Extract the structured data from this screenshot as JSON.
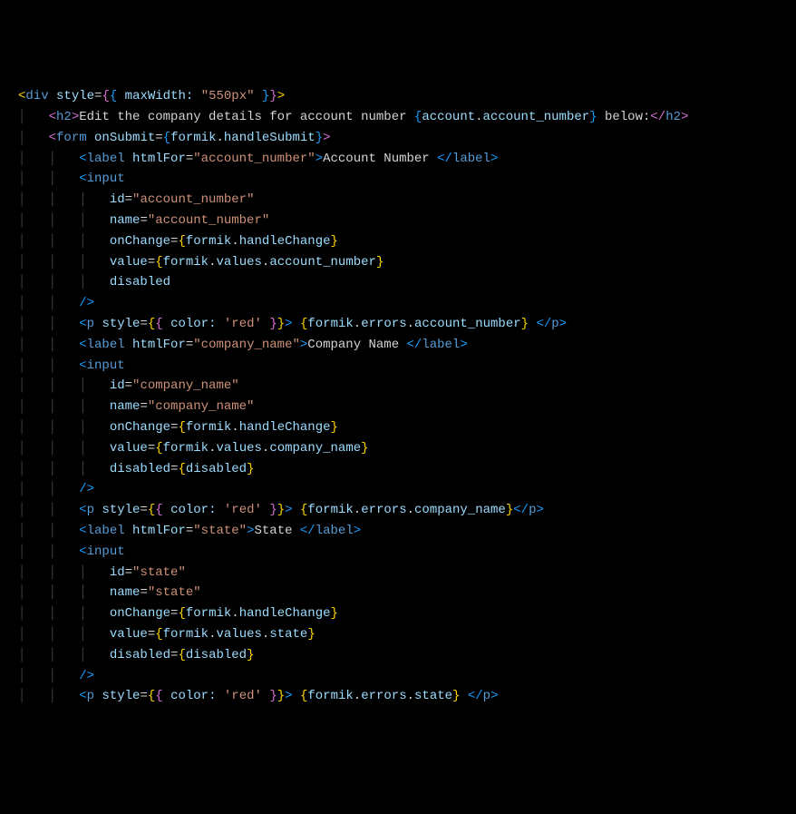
{
  "lines": [
    {
      "indent": 0,
      "segments": [
        {
          "t": "<",
          "c": "bracket-yellow"
        },
        {
          "t": "div",
          "c": "tag"
        },
        {
          "t": " ",
          "c": "text"
        },
        {
          "t": "style",
          "c": "attr-name"
        },
        {
          "t": "=",
          "c": "equals"
        },
        {
          "t": "{",
          "c": "bracket-purple"
        },
        {
          "t": "{",
          "c": "bracket-blue"
        },
        {
          "t": " ",
          "c": "text"
        },
        {
          "t": "maxWidth:",
          "c": "jsx-expr"
        },
        {
          "t": " ",
          "c": "text"
        },
        {
          "t": "\"550px\"",
          "c": "attr-string"
        },
        {
          "t": " ",
          "c": "text"
        },
        {
          "t": "}",
          "c": "bracket-blue"
        },
        {
          "t": "}",
          "c": "bracket-purple"
        },
        {
          "t": ">",
          "c": "bracket-yellow"
        }
      ]
    },
    {
      "indent": 1,
      "segments": [
        {
          "t": "<",
          "c": "bracket-purple"
        },
        {
          "t": "h2",
          "c": "tag"
        },
        {
          "t": ">",
          "c": "bracket-purple"
        },
        {
          "t": "Edit the company details for account number ",
          "c": "text"
        },
        {
          "t": "{",
          "c": "bracket-blue"
        },
        {
          "t": "account",
          "c": "jsx-expr"
        },
        {
          "t": ".",
          "c": "dot"
        },
        {
          "t": "account_number",
          "c": "jsx-expr"
        },
        {
          "t": "}",
          "c": "bracket-blue"
        },
        {
          "t": " below:",
          "c": "text"
        },
        {
          "t": "</",
          "c": "bracket-purple"
        },
        {
          "t": "h2",
          "c": "tag"
        },
        {
          "t": ">",
          "c": "bracket-purple"
        }
      ]
    },
    {
      "indent": 1,
      "segments": [
        {
          "t": "<",
          "c": "bracket-purple"
        },
        {
          "t": "form",
          "c": "tag"
        },
        {
          "t": " ",
          "c": "text"
        },
        {
          "t": "onSubmit",
          "c": "attr-name"
        },
        {
          "t": "=",
          "c": "equals"
        },
        {
          "t": "{",
          "c": "bracket-blue"
        },
        {
          "t": "formik",
          "c": "jsx-expr"
        },
        {
          "t": ".",
          "c": "dot"
        },
        {
          "t": "handleSubmit",
          "c": "jsx-expr"
        },
        {
          "t": "}",
          "c": "bracket-blue"
        },
        {
          "t": ">",
          "c": "bracket-purple"
        }
      ]
    },
    {
      "indent": 2,
      "segments": [
        {
          "t": "<",
          "c": "bracket-blue"
        },
        {
          "t": "label",
          "c": "tag"
        },
        {
          "t": " ",
          "c": "text"
        },
        {
          "t": "htmlFor",
          "c": "attr-name"
        },
        {
          "t": "=",
          "c": "equals"
        },
        {
          "t": "\"account_number\"",
          "c": "attr-string"
        },
        {
          "t": ">",
          "c": "bracket-blue"
        },
        {
          "t": "Account Number ",
          "c": "text"
        },
        {
          "t": "</",
          "c": "bracket-blue"
        },
        {
          "t": "label",
          "c": "tag"
        },
        {
          "t": ">",
          "c": "bracket-blue"
        }
      ]
    },
    {
      "indent": 2,
      "segments": [
        {
          "t": "<",
          "c": "bracket-blue"
        },
        {
          "t": "input",
          "c": "tag"
        }
      ]
    },
    {
      "indent": 3,
      "guide": true,
      "segments": [
        {
          "t": "id",
          "c": "attr-name"
        },
        {
          "t": "=",
          "c": "equals"
        },
        {
          "t": "\"account_number\"",
          "c": "attr-string"
        }
      ]
    },
    {
      "indent": 3,
      "guide": true,
      "segments": [
        {
          "t": "name",
          "c": "attr-name"
        },
        {
          "t": "=",
          "c": "equals"
        },
        {
          "t": "\"account_number\"",
          "c": "attr-string"
        }
      ]
    },
    {
      "indent": 3,
      "guide": true,
      "segments": [
        {
          "t": "onChange",
          "c": "attr-name"
        },
        {
          "t": "=",
          "c": "equals"
        },
        {
          "t": "{",
          "c": "bracket-yellow"
        },
        {
          "t": "formik",
          "c": "jsx-expr"
        },
        {
          "t": ".",
          "c": "dot"
        },
        {
          "t": "handleChange",
          "c": "jsx-expr"
        },
        {
          "t": "}",
          "c": "bracket-yellow"
        }
      ]
    },
    {
      "indent": 3,
      "guide": true,
      "segments": [
        {
          "t": "value",
          "c": "attr-name"
        },
        {
          "t": "=",
          "c": "equals"
        },
        {
          "t": "{",
          "c": "bracket-yellow"
        },
        {
          "t": "formik",
          "c": "jsx-expr"
        },
        {
          "t": ".",
          "c": "dot"
        },
        {
          "t": "values",
          "c": "jsx-expr"
        },
        {
          "t": ".",
          "c": "dot"
        },
        {
          "t": "account_number",
          "c": "jsx-expr"
        },
        {
          "t": "}",
          "c": "bracket-yellow"
        }
      ]
    },
    {
      "indent": 3,
      "guide": true,
      "segments": [
        {
          "t": "disabled",
          "c": "attr-name"
        }
      ]
    },
    {
      "indent": 2,
      "segments": [
        {
          "t": "/>",
          "c": "bracket-blue"
        }
      ]
    },
    {
      "indent": 2,
      "segments": [
        {
          "t": "<",
          "c": "bracket-blue"
        },
        {
          "t": "p",
          "c": "tag"
        },
        {
          "t": " ",
          "c": "text"
        },
        {
          "t": "style",
          "c": "attr-name"
        },
        {
          "t": "=",
          "c": "equals"
        },
        {
          "t": "{",
          "c": "bracket-yellow"
        },
        {
          "t": "{",
          "c": "bracket-purple"
        },
        {
          "t": " ",
          "c": "text"
        },
        {
          "t": "color:",
          "c": "jsx-expr"
        },
        {
          "t": " ",
          "c": "text"
        },
        {
          "t": "'red'",
          "c": "attr-string"
        },
        {
          "t": " ",
          "c": "text"
        },
        {
          "t": "}",
          "c": "bracket-purple"
        },
        {
          "t": "}",
          "c": "bracket-yellow"
        },
        {
          "t": ">",
          "c": "bracket-blue"
        },
        {
          "t": " ",
          "c": "text"
        },
        {
          "t": "{",
          "c": "bracket-yellow"
        },
        {
          "t": "formik",
          "c": "jsx-expr"
        },
        {
          "t": ".",
          "c": "dot"
        },
        {
          "t": "errors",
          "c": "jsx-expr"
        },
        {
          "t": ".",
          "c": "dot"
        },
        {
          "t": "account_number",
          "c": "jsx-expr"
        },
        {
          "t": "}",
          "c": "bracket-yellow"
        },
        {
          "t": " ",
          "c": "text"
        },
        {
          "t": "</",
          "c": "bracket-blue"
        },
        {
          "t": "p",
          "c": "tag"
        },
        {
          "t": ">",
          "c": "bracket-blue"
        }
      ]
    },
    {
      "indent": 2,
      "segments": [
        {
          "t": "<",
          "c": "bracket-blue"
        },
        {
          "t": "label",
          "c": "tag"
        },
        {
          "t": " ",
          "c": "text"
        },
        {
          "t": "htmlFor",
          "c": "attr-name"
        },
        {
          "t": "=",
          "c": "equals"
        },
        {
          "t": "\"company_name\"",
          "c": "attr-string"
        },
        {
          "t": ">",
          "c": "bracket-blue"
        },
        {
          "t": "Company Name ",
          "c": "text"
        },
        {
          "t": "</",
          "c": "bracket-blue"
        },
        {
          "t": "label",
          "c": "tag"
        },
        {
          "t": ">",
          "c": "bracket-blue"
        }
      ]
    },
    {
      "indent": 2,
      "segments": [
        {
          "t": "<",
          "c": "bracket-blue"
        },
        {
          "t": "input",
          "c": "tag"
        }
      ]
    },
    {
      "indent": 3,
      "guide": true,
      "segments": [
        {
          "t": "id",
          "c": "attr-name"
        },
        {
          "t": "=",
          "c": "equals"
        },
        {
          "t": "\"company_name\"",
          "c": "attr-string"
        }
      ]
    },
    {
      "indent": 3,
      "guide": true,
      "segments": [
        {
          "t": "name",
          "c": "attr-name"
        },
        {
          "t": "=",
          "c": "equals"
        },
        {
          "t": "\"company_name\"",
          "c": "attr-string"
        }
      ]
    },
    {
      "indent": 3,
      "guide": true,
      "segments": [
        {
          "t": "onChange",
          "c": "attr-name"
        },
        {
          "t": "=",
          "c": "equals"
        },
        {
          "t": "{",
          "c": "bracket-yellow"
        },
        {
          "t": "formik",
          "c": "jsx-expr"
        },
        {
          "t": ".",
          "c": "dot"
        },
        {
          "t": "handleChange",
          "c": "jsx-expr"
        },
        {
          "t": "}",
          "c": "bracket-yellow"
        }
      ]
    },
    {
      "indent": 3,
      "guide": true,
      "segments": [
        {
          "t": "value",
          "c": "attr-name"
        },
        {
          "t": "=",
          "c": "equals"
        },
        {
          "t": "{",
          "c": "bracket-yellow"
        },
        {
          "t": "formik",
          "c": "jsx-expr"
        },
        {
          "t": ".",
          "c": "dot"
        },
        {
          "t": "values",
          "c": "jsx-expr"
        },
        {
          "t": ".",
          "c": "dot"
        },
        {
          "t": "company_name",
          "c": "jsx-expr"
        },
        {
          "t": "}",
          "c": "bracket-yellow"
        }
      ]
    },
    {
      "indent": 3,
      "guide": true,
      "segments": [
        {
          "t": "disabled",
          "c": "attr-name"
        },
        {
          "t": "=",
          "c": "equals"
        },
        {
          "t": "{",
          "c": "bracket-yellow"
        },
        {
          "t": "disabled",
          "c": "jsx-expr"
        },
        {
          "t": "}",
          "c": "bracket-yellow"
        }
      ]
    },
    {
      "indent": 2,
      "segments": [
        {
          "t": "/>",
          "c": "bracket-blue"
        }
      ]
    },
    {
      "indent": 2,
      "segments": [
        {
          "t": "<",
          "c": "bracket-blue"
        },
        {
          "t": "p",
          "c": "tag"
        },
        {
          "t": " ",
          "c": "text"
        },
        {
          "t": "style",
          "c": "attr-name"
        },
        {
          "t": "=",
          "c": "equals"
        },
        {
          "t": "{",
          "c": "bracket-yellow"
        },
        {
          "t": "{",
          "c": "bracket-purple"
        },
        {
          "t": " ",
          "c": "text"
        },
        {
          "t": "color:",
          "c": "jsx-expr"
        },
        {
          "t": " ",
          "c": "text"
        },
        {
          "t": "'red'",
          "c": "attr-string"
        },
        {
          "t": " ",
          "c": "text"
        },
        {
          "t": "}",
          "c": "bracket-purple"
        },
        {
          "t": "}",
          "c": "bracket-yellow"
        },
        {
          "t": ">",
          "c": "bracket-blue"
        },
        {
          "t": " ",
          "c": "text"
        },
        {
          "t": "{",
          "c": "bracket-yellow"
        },
        {
          "t": "formik",
          "c": "jsx-expr"
        },
        {
          "t": ".",
          "c": "dot"
        },
        {
          "t": "errors",
          "c": "jsx-expr"
        },
        {
          "t": ".",
          "c": "dot"
        },
        {
          "t": "company_name",
          "c": "jsx-expr"
        },
        {
          "t": "}",
          "c": "bracket-yellow"
        },
        {
          "t": "</",
          "c": "bracket-blue"
        },
        {
          "t": "p",
          "c": "tag"
        },
        {
          "t": ">",
          "c": "bracket-blue"
        }
      ]
    },
    {
      "indent": 2,
      "segments": [
        {
          "t": "<",
          "c": "bracket-blue"
        },
        {
          "t": "label",
          "c": "tag"
        },
        {
          "t": " ",
          "c": "text"
        },
        {
          "t": "htmlFor",
          "c": "attr-name"
        },
        {
          "t": "=",
          "c": "equals"
        },
        {
          "t": "\"state\"",
          "c": "attr-string"
        },
        {
          "t": ">",
          "c": "bracket-blue"
        },
        {
          "t": "State ",
          "c": "text"
        },
        {
          "t": "</",
          "c": "bracket-blue"
        },
        {
          "t": "label",
          "c": "tag"
        },
        {
          "t": ">",
          "c": "bracket-blue"
        }
      ]
    },
    {
      "indent": 2,
      "segments": [
        {
          "t": "<",
          "c": "bracket-blue"
        },
        {
          "t": "input",
          "c": "tag"
        }
      ]
    },
    {
      "indent": 3,
      "guide": true,
      "segments": [
        {
          "t": "id",
          "c": "attr-name"
        },
        {
          "t": "=",
          "c": "equals"
        },
        {
          "t": "\"state\"",
          "c": "attr-string"
        }
      ]
    },
    {
      "indent": 3,
      "guide": true,
      "segments": [
        {
          "t": "name",
          "c": "attr-name"
        },
        {
          "t": "=",
          "c": "equals"
        },
        {
          "t": "\"state\"",
          "c": "attr-string"
        }
      ]
    },
    {
      "indent": 3,
      "guide": true,
      "segments": [
        {
          "t": "onChange",
          "c": "attr-name"
        },
        {
          "t": "=",
          "c": "equals"
        },
        {
          "t": "{",
          "c": "bracket-yellow"
        },
        {
          "t": "formik",
          "c": "jsx-expr"
        },
        {
          "t": ".",
          "c": "dot"
        },
        {
          "t": "handleChange",
          "c": "jsx-expr"
        },
        {
          "t": "}",
          "c": "bracket-yellow"
        }
      ]
    },
    {
      "indent": 3,
      "guide": true,
      "segments": [
        {
          "t": "value",
          "c": "attr-name"
        },
        {
          "t": "=",
          "c": "equals"
        },
        {
          "t": "{",
          "c": "bracket-yellow"
        },
        {
          "t": "formik",
          "c": "jsx-expr"
        },
        {
          "t": ".",
          "c": "dot"
        },
        {
          "t": "values",
          "c": "jsx-expr"
        },
        {
          "t": ".",
          "c": "dot"
        },
        {
          "t": "state",
          "c": "jsx-expr"
        },
        {
          "t": "}",
          "c": "bracket-yellow"
        }
      ]
    },
    {
      "indent": 3,
      "guide": true,
      "segments": [
        {
          "t": "disabled",
          "c": "attr-name"
        },
        {
          "t": "=",
          "c": "equals"
        },
        {
          "t": "{",
          "c": "bracket-yellow"
        },
        {
          "t": "disabled",
          "c": "jsx-expr"
        },
        {
          "t": "}",
          "c": "bracket-yellow"
        }
      ]
    },
    {
      "indent": 2,
      "segments": [
        {
          "t": "/>",
          "c": "bracket-blue"
        }
      ]
    },
    {
      "indent": 2,
      "segments": [
        {
          "t": "<",
          "c": "bracket-blue"
        },
        {
          "t": "p",
          "c": "tag"
        },
        {
          "t": " ",
          "c": "text"
        },
        {
          "t": "style",
          "c": "attr-name"
        },
        {
          "t": "=",
          "c": "equals"
        },
        {
          "t": "{",
          "c": "bracket-yellow"
        },
        {
          "t": "{",
          "c": "bracket-purple"
        },
        {
          "t": " ",
          "c": "text"
        },
        {
          "t": "color:",
          "c": "jsx-expr"
        },
        {
          "t": " ",
          "c": "text"
        },
        {
          "t": "'red'",
          "c": "attr-string"
        },
        {
          "t": " ",
          "c": "text"
        },
        {
          "t": "}",
          "c": "bracket-purple"
        },
        {
          "t": "}",
          "c": "bracket-yellow"
        },
        {
          "t": ">",
          "c": "bracket-blue"
        },
        {
          "t": " ",
          "c": "text"
        },
        {
          "t": "{",
          "c": "bracket-yellow"
        },
        {
          "t": "formik",
          "c": "jsx-expr"
        },
        {
          "t": ".",
          "c": "dot"
        },
        {
          "t": "errors",
          "c": "jsx-expr"
        },
        {
          "t": ".",
          "c": "dot"
        },
        {
          "t": "state",
          "c": "jsx-expr"
        },
        {
          "t": "}",
          "c": "bracket-yellow"
        },
        {
          "t": " ",
          "c": "text"
        },
        {
          "t": "</",
          "c": "bracket-blue"
        },
        {
          "t": "p",
          "c": "tag"
        },
        {
          "t": ">",
          "c": "bracket-blue"
        }
      ]
    }
  ]
}
